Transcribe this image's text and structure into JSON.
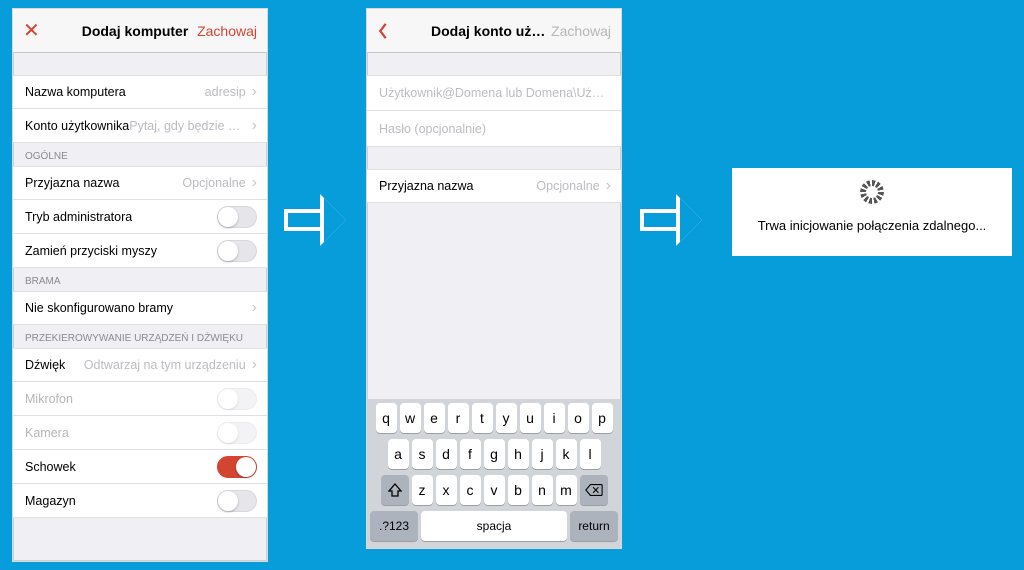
{
  "screen1": {
    "nav": {
      "close_glyph": "✕",
      "title": "Dodaj komputer",
      "save": "Zachowaj"
    },
    "pc_name": {
      "label": "Nazwa komputera",
      "value": "adresip"
    },
    "user_acct": {
      "label": "Konto użytkownika",
      "value": "Pytaj, gdy będzie wy…"
    },
    "section_general": "OGÓLNE",
    "friendly_name": {
      "label": "Przyjazna nazwa",
      "value": "Opcjonalne"
    },
    "admin_mode": {
      "label": "Tryb administratora"
    },
    "swap_mouse": {
      "label": "Zamień przyciski myszy"
    },
    "section_gateway": "BRAMA",
    "gateway": {
      "label": "Nie skonfigurowano bramy"
    },
    "section_redirect": "PRZEKIEROWYWANIE URZĄDZEŃ I DŹWIĘKU",
    "sound": {
      "label": "Dźwięk",
      "value": "Odtwarzaj na tym urządzeniu"
    },
    "microphone": {
      "label": "Mikrofon"
    },
    "camera": {
      "label": "Kamera"
    },
    "clipboard": {
      "label": "Schowek"
    },
    "storage": {
      "label": "Magazyn"
    }
  },
  "screen2": {
    "nav": {
      "title": "Dodaj konto użytkownika",
      "save": "Zachowaj"
    },
    "username_placeholder": "Użytkownik@Domena lub Domena\\Uży…",
    "password_placeholder": "Hasło (opcjonalnie)",
    "friendly_name": {
      "label": "Przyjazna nazwa",
      "value": "Opcjonalne"
    }
  },
  "keyboard": {
    "row1": [
      "q",
      "w",
      "e",
      "r",
      "t",
      "y",
      "u",
      "i",
      "o",
      "p"
    ],
    "row2": [
      "a",
      "s",
      "d",
      "f",
      "g",
      "h",
      "j",
      "k",
      "l"
    ],
    "row3": [
      "z",
      "x",
      "c",
      "v",
      "b",
      "n",
      "m"
    ],
    "mode_key": ".?123",
    "space": "spacja",
    "return": "return"
  },
  "loading": {
    "message": "Trwa inicjowanie połączenia zdalnego..."
  }
}
